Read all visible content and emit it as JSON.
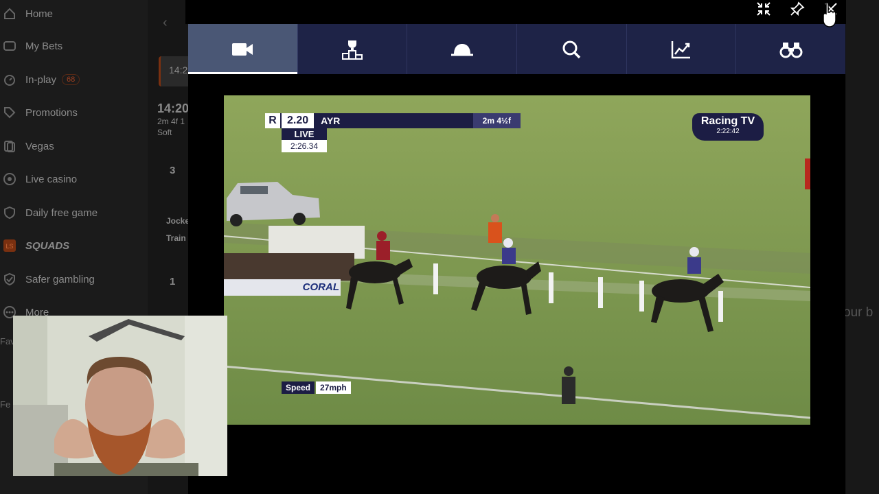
{
  "sidebar": {
    "items": [
      {
        "label": "Home",
        "icon": "home-icon"
      },
      {
        "label": "My Bets",
        "icon": "bets-icon"
      },
      {
        "label": "In-play",
        "icon": "stopwatch-icon",
        "badge": "68"
      },
      {
        "label": "Promotions",
        "icon": "tag-icon"
      },
      {
        "label": "Vegas",
        "icon": "cards-icon"
      },
      {
        "label": "Live casino",
        "icon": "chip-icon"
      },
      {
        "label": "Daily free game",
        "icon": "shield-icon"
      },
      {
        "label": "SQUADS",
        "icon": "squads-icon"
      },
      {
        "label": "Safer gambling",
        "icon": "safe-shield-icon"
      },
      {
        "label": "More",
        "icon": "more-icon"
      }
    ],
    "partial_labels": [
      "Fav",
      "Fe"
    ]
  },
  "background_page": {
    "time_tab": "14:2",
    "race_time": "14:20",
    "race_sub": "2m 4f 1",
    "going": "Soft",
    "runner_num_1": "3",
    "jockey_label": "Jocke",
    "trainer_label": "Train",
    "runner_num_2": "1",
    "right_text": "our b"
  },
  "modal": {
    "header_buttons": [
      "minimize-icon",
      "pin-icon",
      "close-icon"
    ],
    "tabs": [
      {
        "icon": "video-camera-icon",
        "active": true
      },
      {
        "icon": "podium-icon",
        "active": false
      },
      {
        "icon": "jockey-cap-icon",
        "active": false
      },
      {
        "icon": "search-icon",
        "active": false
      },
      {
        "icon": "chart-icon",
        "active": false
      },
      {
        "icon": "binoculars-icon",
        "active": false
      }
    ]
  },
  "video": {
    "race_time": "2.20",
    "course": "AYR",
    "distance": "2m 4½f",
    "live_label": "LIVE",
    "race_clock": "2:26.34",
    "channel": "Racing TV",
    "channel_clock": "2:22:42",
    "speed_label": "Speed",
    "speed_value": "27mph",
    "sponsor": "CORAL"
  },
  "colors": {
    "tab_bar": "#1e2347",
    "tab_active": "#4a5775",
    "overlay_navy": "#1c1d44",
    "grass": "#7f9a52"
  }
}
